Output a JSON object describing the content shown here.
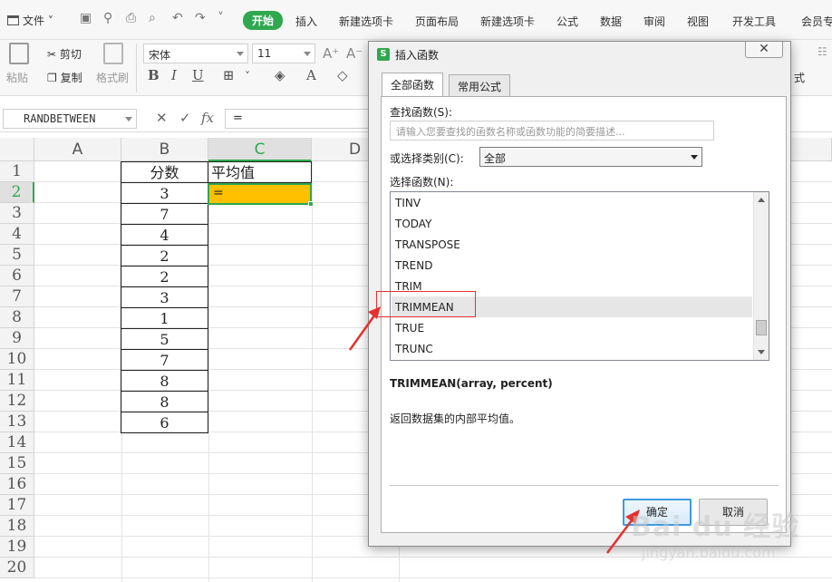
{
  "menubar": {
    "file_label": "文件",
    "tabs": [
      "开始",
      "插入",
      "新建选项卡",
      "页面布局",
      "新建选项卡",
      "公式",
      "数据",
      "审阅",
      "视图",
      "开发工具",
      "会员专"
    ],
    "active_tab": "开始",
    "accent_color": "#2fa84f"
  },
  "ribbon": {
    "paste_label": "粘贴",
    "cut_label": "剪切",
    "copy_label": "复制",
    "format_painter_label": "格式刷",
    "font_name": "宋体",
    "font_size": "11",
    "bold": "B",
    "italic": "I",
    "underline": "U",
    "right_label": "式"
  },
  "formula_bar": {
    "name_box": "RANDBETWEEN",
    "cancel": "✕",
    "confirm": "✓",
    "fx": "fx",
    "formula": "="
  },
  "sheet": {
    "columns": [
      "A",
      "B",
      "C",
      "D"
    ],
    "rows": [
      "1",
      "2",
      "3",
      "4",
      "5",
      "6",
      "7",
      "8",
      "9",
      "10",
      "11",
      "12",
      "13",
      "14",
      "15",
      "16",
      "17",
      "18",
      "19",
      "20"
    ],
    "selected_column": "C",
    "selected_row": "2",
    "header_score": "分数",
    "header_avg": "平均值",
    "scores": [
      "3",
      "7",
      "4",
      "2",
      "2",
      "3",
      "1",
      "5",
      "7",
      "8",
      "8",
      "6"
    ],
    "active_cell_value": "=",
    "active_cell_color": "#ffc000"
  },
  "dialog": {
    "title": "插入函数",
    "close": "✕",
    "tabs": [
      "全部函数",
      "常用公式"
    ],
    "search_label": "查找函数(S):",
    "search_placeholder": "请输入您要查找的函数名称或函数功能的简要描述...",
    "category_label": "或选择类别(C):",
    "category_value": "全部",
    "list_label": "选择函数(N):",
    "functions": [
      "TINV",
      "TODAY",
      "TRANSPOSE",
      "TREND",
      "TRIM",
      "TRIMMEAN",
      "TRUE",
      "TRUNC"
    ],
    "selected_function": "TRIMMEAN",
    "syntax": "TRIMMEAN(array, percent)",
    "description": "返回数据集的内部平均值。",
    "ok_label": "确定",
    "cancel_label": "取消"
  },
  "watermark": {
    "brand": "Bai du 经验",
    "url": "jingyan.baidu.com"
  },
  "annotation_color": "#e5302e"
}
